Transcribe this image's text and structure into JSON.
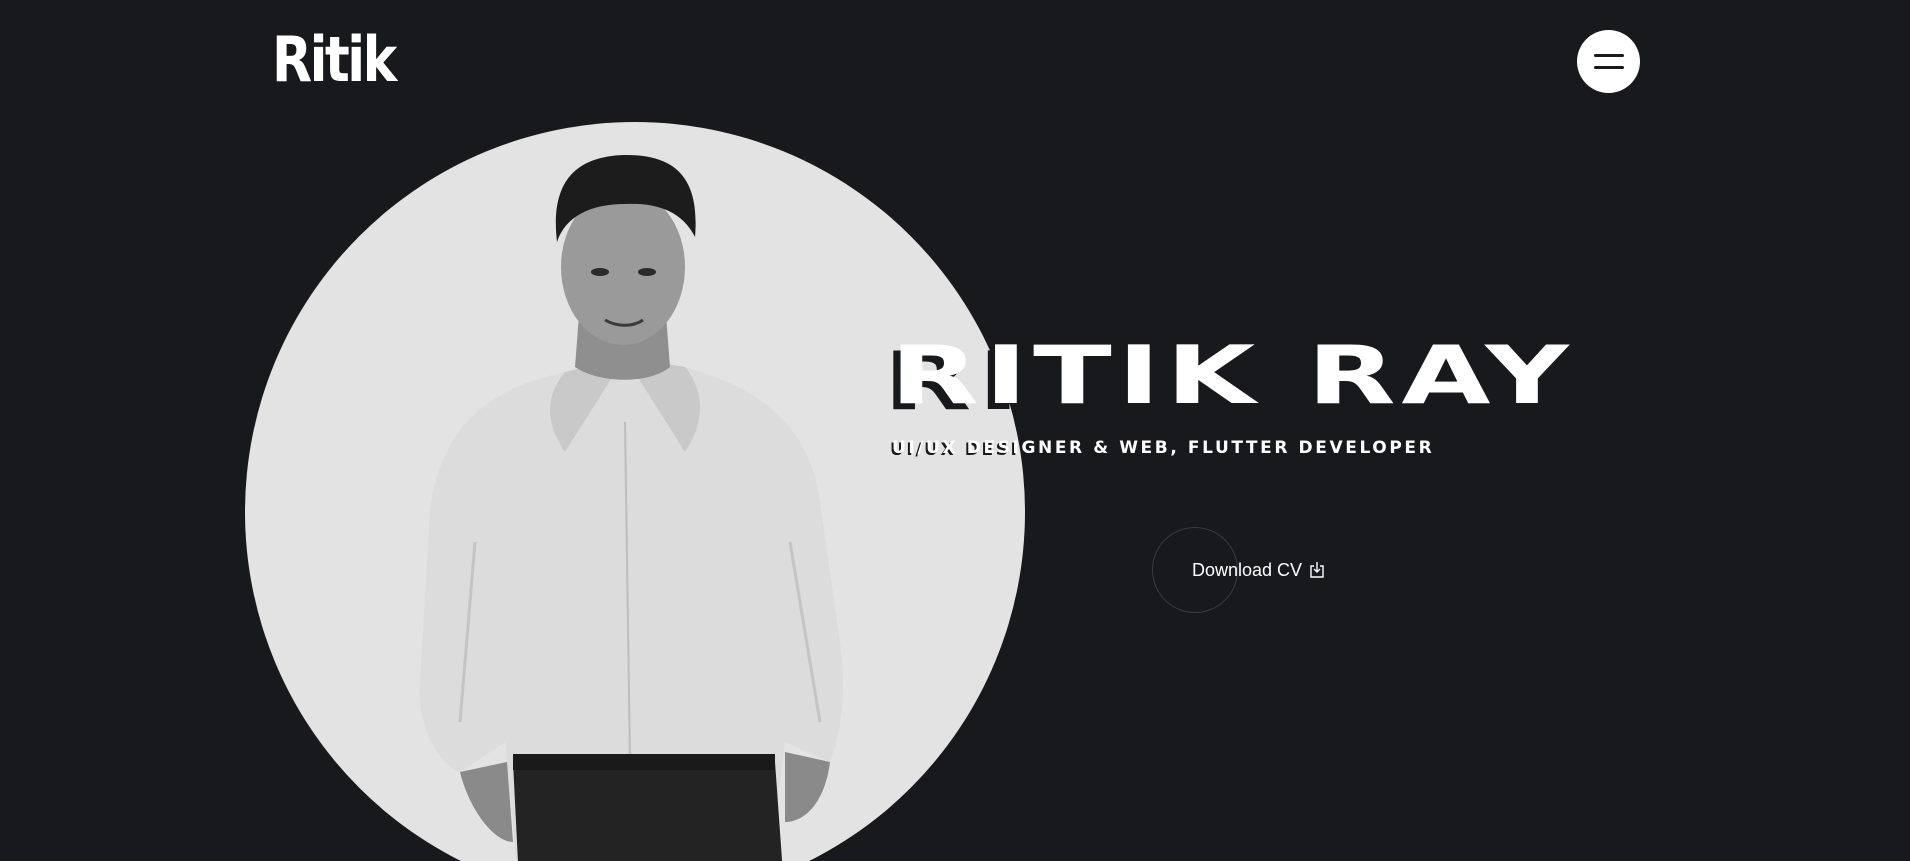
{
  "header": {
    "logo": "Ritik",
    "menu_icon": "hamburger-menu-icon"
  },
  "hero": {
    "name": "RITIK RAY",
    "subtitle": "UI/UX DESIGNER & WEB, FLUTTER DEVELOPER",
    "cta_label": "Download CV",
    "cta_icon": "download-icon",
    "photo": "portrait-photo"
  },
  "colors": {
    "background": "#18191d",
    "text": "#ffffff",
    "photo_backdrop": "#e3e3e4",
    "ring": "#3a3b40"
  }
}
